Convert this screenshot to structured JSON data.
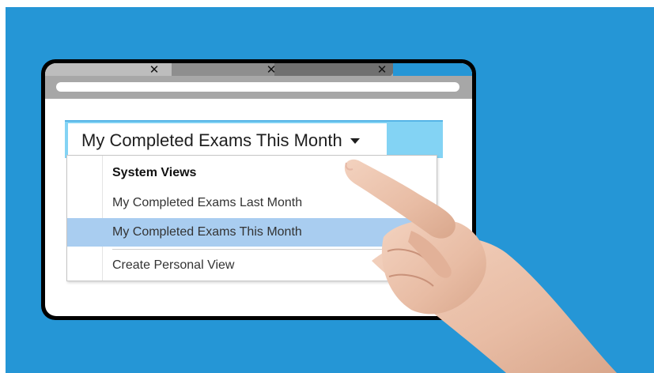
{
  "view_selector": {
    "current_view": "My Completed Exams This Month"
  },
  "dropdown": {
    "heading": "System Views",
    "items": [
      {
        "label": "My Completed Exams Last Month",
        "selected": false
      },
      {
        "label": "My Completed Exams This Month",
        "selected": true
      }
    ],
    "create_label": "Create Personal View"
  },
  "browser_tabs": {
    "close_glyph": "✕"
  },
  "colors": {
    "background": "#2596d6",
    "header": "#83d3f4",
    "selected_item": "#a9cdf0"
  },
  "icons": [
    "tab-close-icon",
    "dropdown-caret-icon",
    "pointing-hand"
  ]
}
